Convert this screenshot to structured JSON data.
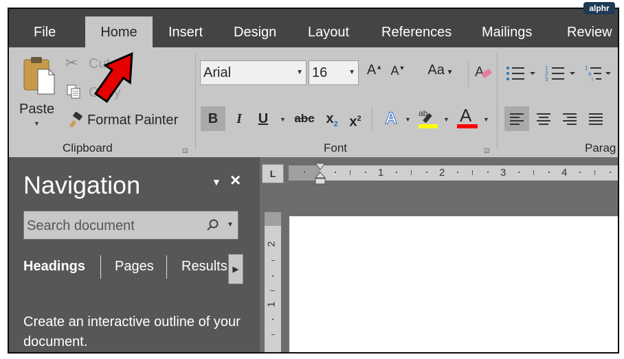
{
  "watermark": "alphr",
  "tabs": [
    "File",
    "Home",
    "Insert",
    "Design",
    "Layout",
    "References",
    "Mailings",
    "Review"
  ],
  "clipboard": {
    "paste_label": "Paste",
    "cut_label": "Cut",
    "copy_label": "Copy",
    "format_painter_label": "Format Painter",
    "group_label": "Clipboard"
  },
  "font": {
    "name": "Arial",
    "size": "16",
    "change_case_label": "Aa",
    "bold": "B",
    "italic": "I",
    "underline": "U",
    "strikethrough": "abc",
    "subscript": "x",
    "subscript_sub": "2",
    "superscript": "x",
    "superscript_sup": "2",
    "grow_label": "A",
    "shrink_label": "A",
    "effects_label": "A",
    "font_color_label": "A",
    "group_label": "Font"
  },
  "paragraph": {
    "group_label": "Parag"
  },
  "colors": {
    "highlight": "#ffff00",
    "font_color": "#ff0000",
    "effects": "#4a90e2",
    "arrow": "#e60000"
  },
  "navigation": {
    "title": "Navigation",
    "search_placeholder": "Search document",
    "tabs": [
      "Headings",
      "Pages",
      "Results"
    ],
    "description": "Create an interactive outline of your document."
  },
  "ruler": {
    "h_numbers": [
      "1",
      "2",
      "3",
      "4"
    ],
    "v_numbers": [
      "2",
      "1"
    ],
    "corner": "L"
  }
}
